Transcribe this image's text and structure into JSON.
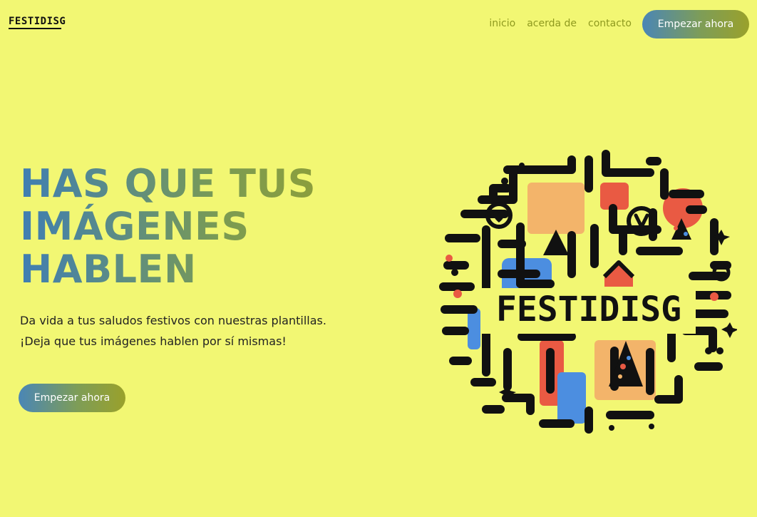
{
  "header": {
    "logo_text": "FESTIDISG",
    "nav": {
      "items": [
        {
          "label": "inicio"
        },
        {
          "label": "acerda de"
        },
        {
          "label": "contacto"
        }
      ]
    },
    "cta_label": "Empezar ahora"
  },
  "hero": {
    "title_line1": "HAS QUE TUS",
    "title_line2": "IMÁGENES",
    "title_line3": "HABLEN",
    "subtitle_line1": "Da vida a tus saludos festivos con nuestras plantillas.",
    "subtitle_line2": "¡Deja que tus imágenes hablen por sí mismas!",
    "cta_label": "Empezar ahora"
  },
  "illustration": {
    "logo_text": "FESTIDISG"
  },
  "colors": {
    "background": "#f2f773",
    "nav_text": "#8f9a1f",
    "gradient_start": "#4a86b6",
    "gradient_end": "#9aa12b",
    "illustration_black": "#111111",
    "illustration_red": "#e95a43",
    "illustration_blue": "#4c8ee0",
    "illustration_orange": "#f3b46a"
  }
}
